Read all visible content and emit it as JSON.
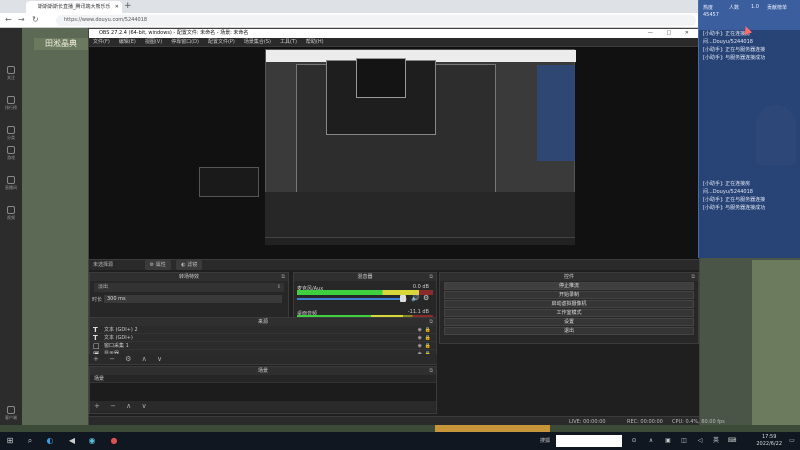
{
  "browser": {
    "tab_title": "斯斯斯斯长直播_腾讯端大熊乐乐",
    "url": "https://www.douyu.com/5244018"
  },
  "page": {
    "room_badge": "田淞晶典",
    "rail": [
      "关注",
      "排行榜",
      "分类",
      "游戏",
      "直播间",
      "视频"
    ],
    "rail_bottom": "客户端"
  },
  "obs": {
    "title": "OBS 27.2.4 (64-bit, windows) - 配置文件: 未命名 - 场景: 未命名",
    "menu": [
      "文件(F)",
      "编辑(E)",
      "视图(V)",
      "停靠窗口(D)",
      "配置文件(P)",
      "场景集合(S)",
      "工具(T)",
      "帮助(H)"
    ],
    "scene_tabrow": {
      "label": "未选择源",
      "properties": "属性",
      "filters": "滤镜"
    },
    "transitions": {
      "header": "转场特效",
      "selected": "淡出",
      "duration_label": "时长",
      "duration_value": "300 ms"
    },
    "sources": {
      "header": "来源",
      "items": [
        {
          "icon": "T",
          "name": "文本 (GDI+) 2"
        },
        {
          "icon": "T",
          "name": "文本 (GDI+)"
        },
        {
          "icon": "□",
          "name": "窗口采集 1"
        },
        {
          "icon": "▣",
          "name": "显示器"
        }
      ],
      "toolbar": "+ − ⚙ ∧ ∨"
    },
    "scenes": {
      "header": "场景",
      "items": [
        "场景"
      ],
      "toolbar": "+ − ∧ ∨"
    },
    "mixer": {
      "header": "混音器",
      "channels": [
        {
          "name": "麦克风/Aux",
          "db": "0.0 dB",
          "level": 0.9,
          "volume": 0.96
        },
        {
          "name": "桌面音频",
          "db": "-11.1 dB",
          "level": 0.78,
          "volume": 0.58
        }
      ]
    },
    "controls": {
      "header": "控件",
      "buttons": [
        "停止推流",
        "开始录制",
        "启动虚拟摄像机",
        "工作室模式",
        "设置",
        "退出"
      ]
    },
    "status": {
      "live": "LIVE: 00:00:00",
      "rec": "REC: 00:00:00",
      "cpu": "CPU: 0.4%, 60.00 fps"
    }
  },
  "chat": {
    "top_labels": [
      "热度",
      "人数",
      "1.0",
      "贡献榜单"
    ],
    "top_sub": "45457",
    "block1": [
      "[小助手]: 正在连接房",
      "间...Douyu/5244018",
      "[小助手]: 正在与服务器连接",
      "[小助手]: 与服务器连接成功"
    ],
    "block2": [
      "[小助手]: 正在连接房",
      "间...Douyu/5244018",
      "[小助手]: 正在与服务器连接",
      "[小助手]: 与服务器连接成功"
    ]
  },
  "taskbar": {
    "search_label": "搜狐",
    "time": "17:59",
    "date": "2022/6/22"
  }
}
